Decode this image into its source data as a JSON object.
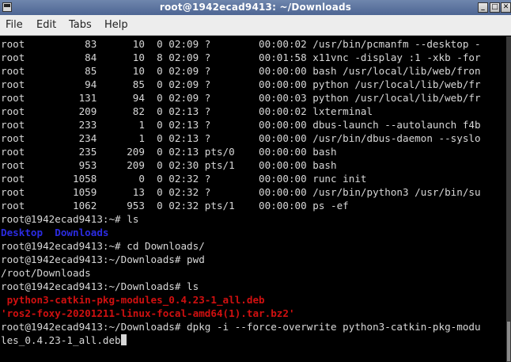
{
  "window": {
    "title": "root@1942ecad9413: ~/Downloads",
    "min_glyph": "_",
    "max_glyph": "□",
    "close_glyph": "✕"
  },
  "menu": {
    "file": "File",
    "edit": "Edit",
    "tabs": "Tabs",
    "help": "Help"
  },
  "terminal": {
    "ps_rows": [
      "root          83      10  0 02:09 ?        00:00:02 /usr/bin/pcmanfm --desktop -",
      "root          84      10  8 02:09 ?        00:01:58 x11vnc -display :1 -xkb -for",
      "root          85      10  0 02:09 ?        00:00:00 bash /usr/local/lib/web/fron",
      "root          94      85  0 02:09 ?        00:00:00 python /usr/local/lib/web/fr",
      "root         131      94  0 02:09 ?        00:00:03 python /usr/local/lib/web/fr",
      "root         209      82  0 02:13 ?        00:00:02 lxterminal",
      "root         233       1  0 02:13 ?        00:00:00 dbus-launch --autolaunch f4b",
      "root         234       1  0 02:13 ?        00:00:00 /usr/bin/dbus-daemon --syslo",
      "root         235     209  0 02:13 pts/0    00:00:00 bash",
      "root         953     209  0 02:30 pts/1    00:00:00 bash",
      "root        1058       0  0 02:32 ?        00:00:00 runc init",
      "root        1059      13  0 02:32 ?        00:00:00 /usr/bin/python3 /usr/bin/su",
      "root        1062     953  0 02:32 pts/1    00:00:00 ps -ef"
    ],
    "prompt_home": "root@1942ecad9413:~# ",
    "prompt_downloads": "root@1942ecad9413:~/Downloads# ",
    "cmd_ls": "ls",
    "ls_home_dir1": "Desktop",
    "ls_home_sep": "  ",
    "ls_home_dir2": "Downloads",
    "cmd_cd": "cd Downloads/",
    "cmd_pwd": "pwd",
    "pwd_output": "/root/Downloads",
    "cmd_ls2": "ls",
    "file1": " python3-catkin-pkg-modules_0.4.23-1_all.deb",
    "file2": "'ros2-foxy-20201211-linux-focal-amd64(1).tar.bz2'",
    "cmd_dpkg_part1": "dpkg -i --force-overwrite python3-catkin-pkg-modu",
    "cmd_dpkg_part2": "les_0.4.23-1_all.deb"
  }
}
